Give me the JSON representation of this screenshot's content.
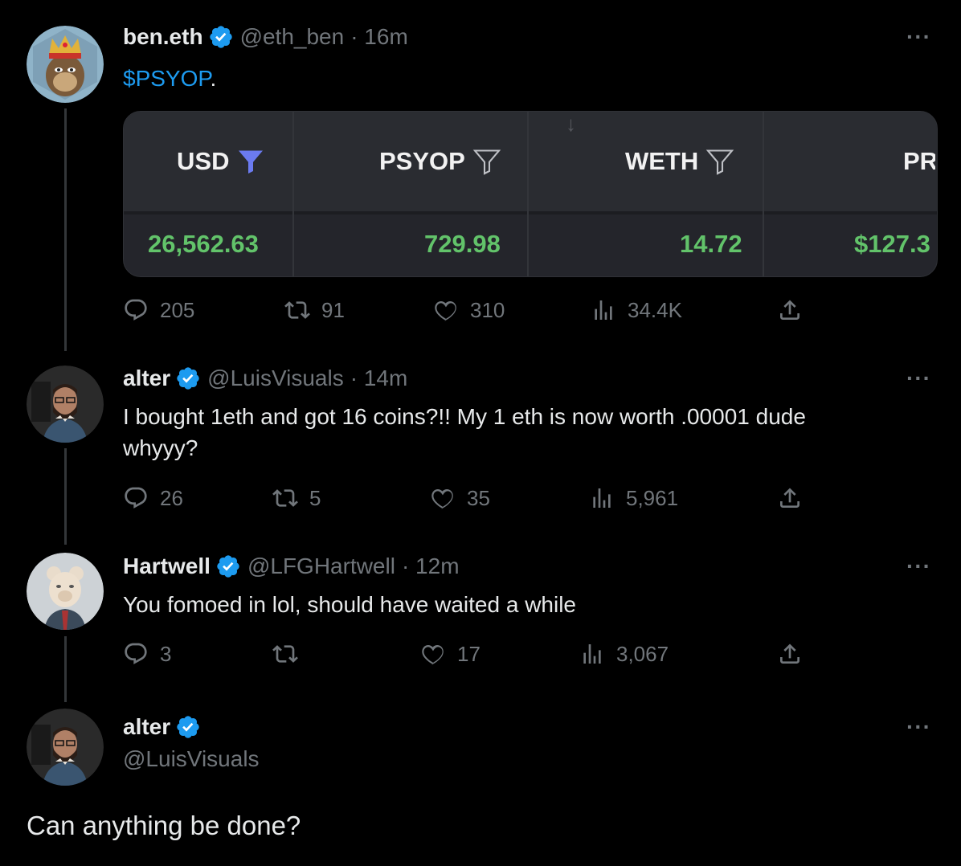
{
  "tweets": [
    {
      "name": "ben.eth",
      "handle": "@eth_ben",
      "time": "· 16m",
      "text_cashtag": "$PSYOP",
      "text_rest": ".",
      "avatar": "ape-with-crown-avatar",
      "card": {
        "columns": [
          {
            "label": "USD",
            "value": "26,562.63",
            "filter": "filled"
          },
          {
            "label": "PSYOP",
            "value": "729.98",
            "filter": "outline"
          },
          {
            "label": "WETH",
            "value": "14.72",
            "filter": "outline"
          },
          {
            "label": "PR",
            "value": "$127.3",
            "filter": "none"
          }
        ]
      },
      "stats": {
        "replies": "205",
        "retweets": "91",
        "likes": "310",
        "views": "34.4K"
      }
    },
    {
      "name": "alter",
      "handle": "@LuisVisuals",
      "time": "· 14m",
      "text_line1": "I bought 1eth and got 16 coins?!! My 1 eth is now worth .00001 dude",
      "text_line2": "whyyy?",
      "avatar": "bearded-man-avatar",
      "stats": {
        "replies": "26",
        "retweets": "5",
        "likes": "35",
        "views": "5,961"
      }
    },
    {
      "name": "Hartwell",
      "handle": "@LFGHartwell",
      "time": "· 12m",
      "text": "You fomoed in lol, should have waited a while",
      "avatar": "bear-in-suit-avatar",
      "stats": {
        "replies": "3",
        "retweets": "",
        "likes": "17",
        "views": "3,067"
      }
    },
    {
      "name": "alter",
      "handle": "@LuisVisuals",
      "text": "Can anything be done?",
      "avatar": "bearded-man-avatar"
    }
  ],
  "colors": {
    "accent": "#1d9bf0",
    "muted": "#71767b",
    "text": "#e7e9ea",
    "green": "#62c36a",
    "background": "#000000"
  },
  "icons": [
    "reply-icon",
    "retweet-icon",
    "like-icon",
    "views-icon",
    "share-icon",
    "more-icon",
    "verified-icon",
    "filter-icon"
  ]
}
